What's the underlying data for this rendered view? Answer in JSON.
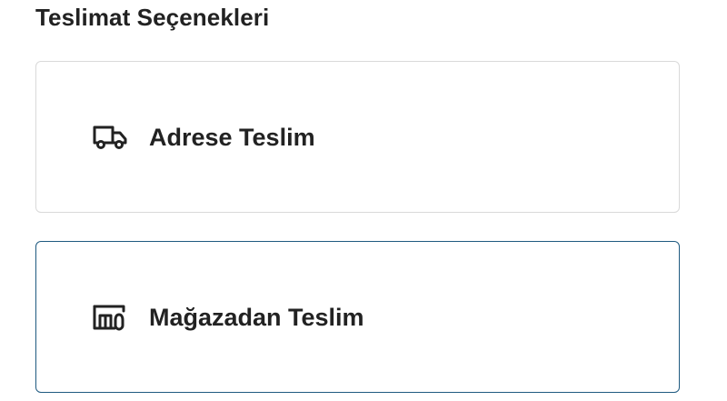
{
  "delivery": {
    "title": "Teslimat Seçenekleri",
    "options": [
      {
        "label": "Adrese Teslim",
        "icon": "truck-icon",
        "selected": false
      },
      {
        "label": "Mağazadan Teslim",
        "icon": "store-icon",
        "selected": true
      }
    ]
  },
  "colors": {
    "selected_border": "#1f5a80",
    "default_border": "#d9d9d9",
    "text": "#222222"
  }
}
